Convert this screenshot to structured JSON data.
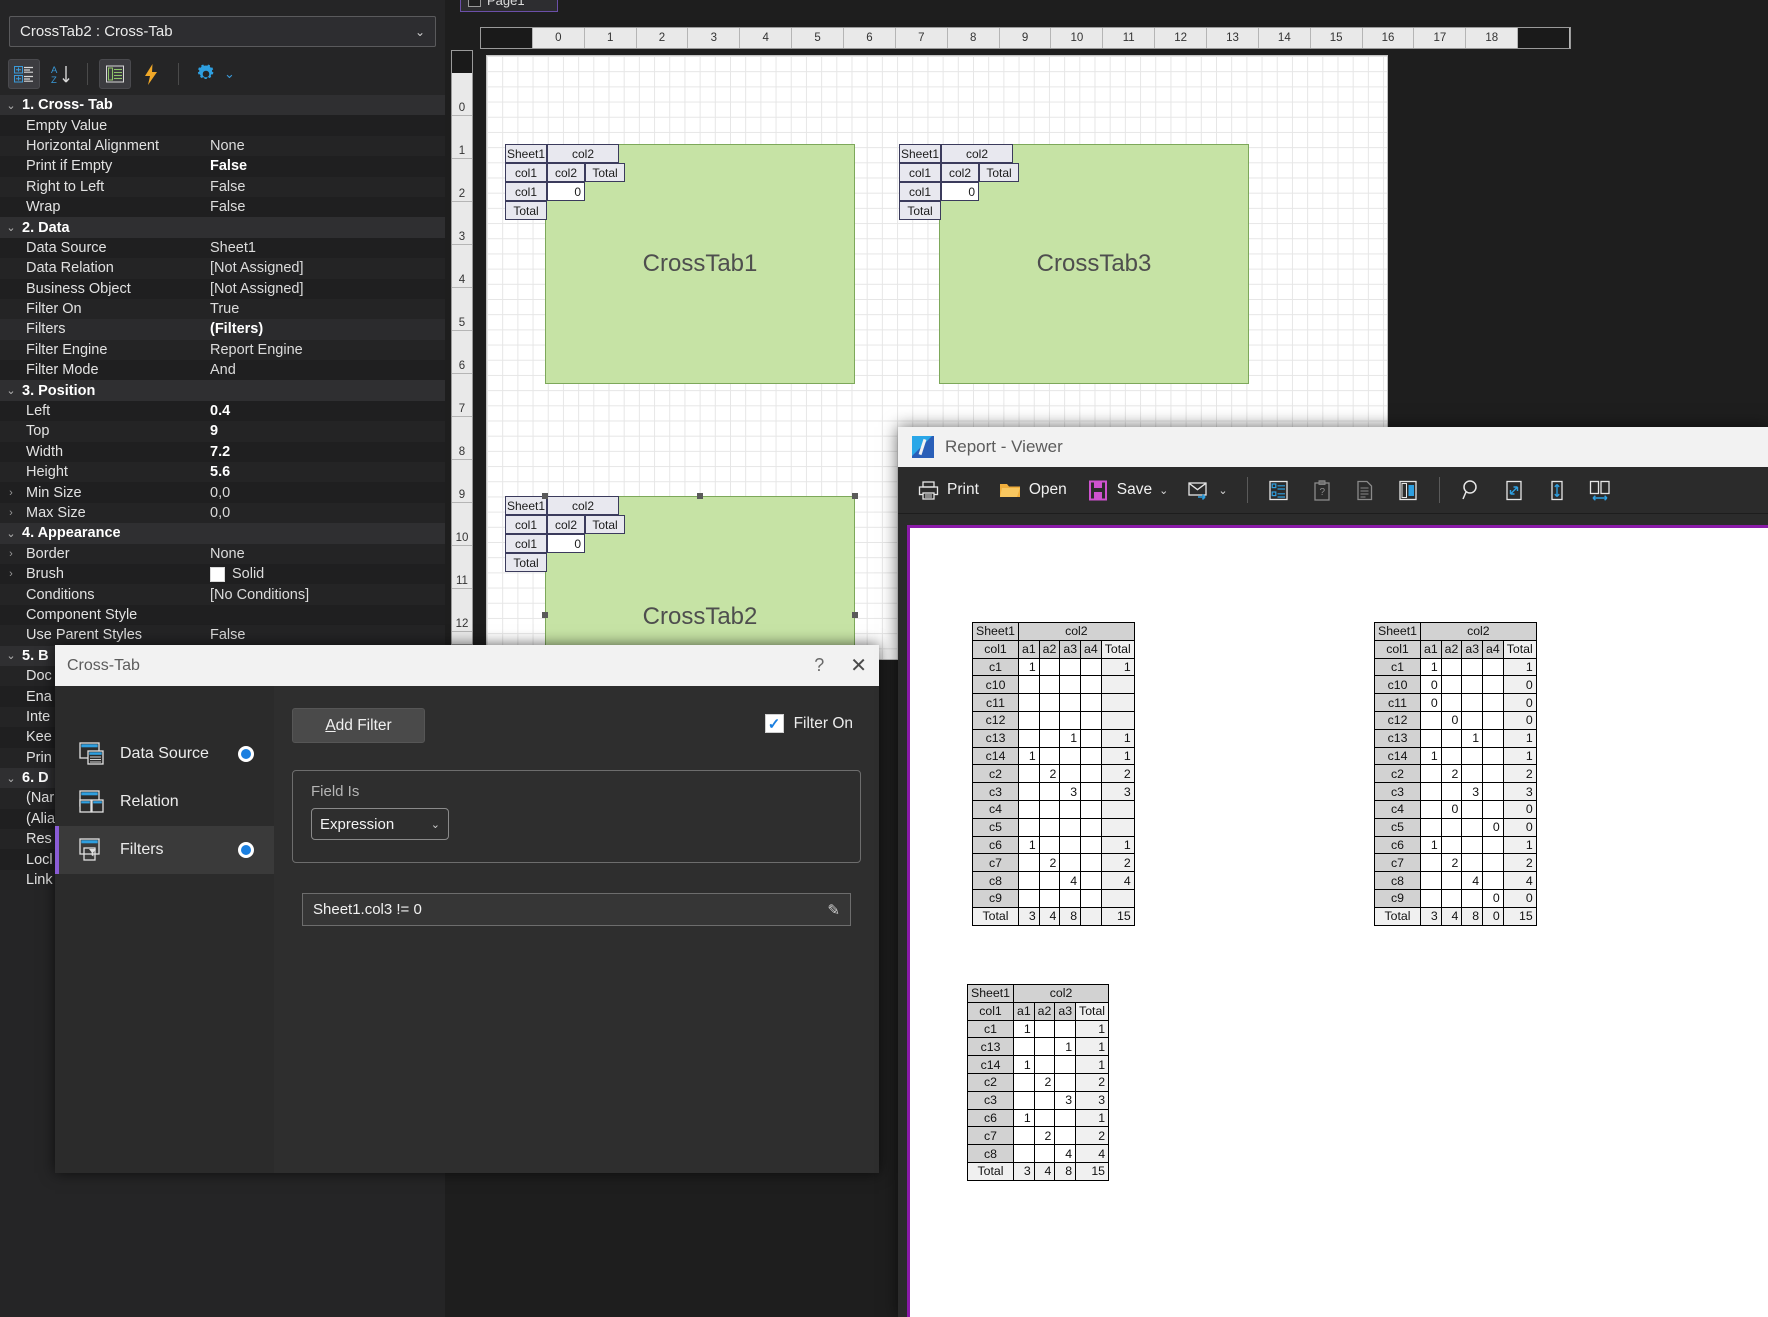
{
  "property_panel": {
    "object_selector": "CrossTab2 : Cross-Tab",
    "toolbar": {
      "categorized_icon": "categorized-view-icon",
      "alphabetical_icon": "alphabetical-sort-icon",
      "properties_icon": "properties-page-icon",
      "events_icon": "events-lightning-icon",
      "settings_icon": "gear-icon",
      "settings_chevron": "chevron-down-icon"
    },
    "groups": [
      {
        "title": "1. Cross- Tab",
        "rows": [
          {
            "name": "Empty Value",
            "value": "",
            "bold": false,
            "expand": false
          },
          {
            "name": "Horizontal Alignment",
            "value": "None",
            "bold": false,
            "expand": false
          },
          {
            "name": "Print if Empty",
            "value": "False",
            "bold": true,
            "expand": false
          },
          {
            "name": "Right to Left",
            "value": "False",
            "bold": false,
            "expand": false
          },
          {
            "name": "Wrap",
            "value": "False",
            "bold": false,
            "expand": false
          }
        ]
      },
      {
        "title": "2. Data",
        "rows": [
          {
            "name": "Data Source",
            "value": "Sheet1",
            "bold": false,
            "expand": false
          },
          {
            "name": "Data Relation",
            "value": "[Not Assigned]",
            "bold": false,
            "expand": false
          },
          {
            "name": "Business Object",
            "value": "[Not Assigned]",
            "bold": false,
            "expand": false
          },
          {
            "name": "Filter On",
            "value": "True",
            "bold": false,
            "expand": false
          },
          {
            "name": "Filters",
            "value": "(Filters)",
            "bold": true,
            "expand": false,
            "selected": true
          },
          {
            "name": "Filter Engine",
            "value": "Report Engine",
            "bold": false,
            "expand": false
          },
          {
            "name": "Filter Mode",
            "value": "And",
            "bold": false,
            "expand": false
          }
        ]
      },
      {
        "title": "3. Position",
        "rows": [
          {
            "name": "Left",
            "value": "0.4",
            "bold": true,
            "expand": false
          },
          {
            "name": "Top",
            "value": "9",
            "bold": true,
            "expand": false
          },
          {
            "name": "Width",
            "value": "7.2",
            "bold": true,
            "expand": false
          },
          {
            "name": "Height",
            "value": "5.6",
            "bold": true,
            "expand": false
          },
          {
            "name": "Min Size",
            "value": "0,0",
            "bold": false,
            "expand": true
          },
          {
            "name": "Max Size",
            "value": "0,0",
            "bold": false,
            "expand": true
          }
        ]
      },
      {
        "title": "4. Appearance",
        "rows": [
          {
            "name": "Border",
            "value": "None",
            "bold": false,
            "expand": true
          },
          {
            "name": "Brush",
            "value": "Solid",
            "bold": false,
            "expand": true,
            "swatch": "#ffffff"
          },
          {
            "name": "Conditions",
            "value": "[No Conditions]",
            "bold": false,
            "expand": false
          },
          {
            "name": "Component Style",
            "value": "",
            "bold": false,
            "expand": false
          },
          {
            "name": "Use Parent Styles",
            "value": "False",
            "bold": false,
            "expand": false
          }
        ]
      },
      {
        "title": "5. B",
        "rows": [
          {
            "name": "Doc",
            "value": "",
            "bold": false,
            "expand": false
          },
          {
            "name": "Ena",
            "value": "",
            "bold": false,
            "expand": false
          },
          {
            "name": "Inte",
            "value": "",
            "bold": false,
            "expand": false
          },
          {
            "name": "Kee",
            "value": "",
            "bold": false,
            "expand": false
          },
          {
            "name": "Prin",
            "value": "",
            "bold": false,
            "expand": false
          }
        ]
      },
      {
        "title": "6. D",
        "rows": [
          {
            "name": "(Nar",
            "value": "",
            "bold": false,
            "expand": false
          },
          {
            "name": "(Alia",
            "value": "",
            "bold": false,
            "expand": false
          },
          {
            "name": "Res",
            "value": "",
            "bold": false,
            "expand": false
          },
          {
            "name": "Locl",
            "value": "",
            "bold": false,
            "expand": false
          },
          {
            "name": "Link",
            "value": "",
            "bold": false,
            "expand": false
          }
        ]
      }
    ]
  },
  "designer": {
    "page_tab_label": "Page1",
    "h_ruler_ticks": [
      "0",
      "1",
      "2",
      "3",
      "4",
      "5",
      "6",
      "7",
      "8",
      "9",
      "10",
      "11",
      "12",
      "13",
      "14",
      "15",
      "16",
      "17",
      "18"
    ],
    "v_ruler_ticks": [
      "0",
      "1",
      "2",
      "3",
      "4",
      "5",
      "6",
      "7",
      "8",
      "9",
      "10",
      "11",
      "12"
    ],
    "crosstabs": [
      {
        "label": "CrossTab1",
        "corner": "Sheet1",
        "col_group": "col2",
        "row_header": "col1",
        "col_header": "col2",
        "total_label": "Total",
        "row_label": "col1",
        "row_total": "Total",
        "value": "0",
        "selected": false
      },
      {
        "label": "CrossTab3",
        "corner": "Sheet1",
        "col_group": "col2",
        "row_header": "col1",
        "col_header": "col2",
        "total_label": "Total",
        "row_label": "col1",
        "row_total": "Total",
        "value": "0",
        "selected": false
      },
      {
        "label": "CrossTab2",
        "corner": "Sheet1",
        "col_group": "col2",
        "row_header": "col1",
        "col_header": "col2",
        "total_label": "Total",
        "row_label": "col1",
        "row_total": "Total",
        "value": "0",
        "selected": true
      }
    ]
  },
  "dialog": {
    "title": "Cross-Tab",
    "help_glyph": "?",
    "close_glyph": "✕",
    "nav": [
      {
        "label": "Data Source",
        "icon": "data-source-icon",
        "radio": true,
        "selected": false
      },
      {
        "label": "Relation",
        "icon": "relation-icon",
        "radio": false,
        "selected": false
      },
      {
        "label": "Filters",
        "icon": "filters-icon",
        "radio": true,
        "selected": true
      }
    ],
    "add_filter_label": "Add Filter",
    "add_filter_accel": "A",
    "filter_on_label": "Filter On",
    "filter_on_checked": true,
    "field_is_label": "Field Is",
    "condition_type": "Expression",
    "expression_value": "Sheet1.col3 != 0",
    "edit_icon": "pencil-icon"
  },
  "viewer": {
    "title": "Report - Viewer",
    "logo": "stimulsoft-logo-icon",
    "toolbar": [
      {
        "label": "Print",
        "icon": "printer-icon",
        "has_chevron": false
      },
      {
        "label": "Open",
        "icon": "folder-open-icon",
        "has_chevron": false
      },
      {
        "label": "Save",
        "icon": "floppy-disk-icon",
        "has_chevron": true
      },
      {
        "label": "",
        "icon": "send-email-icon",
        "has_chevron": true
      },
      {
        "label": "",
        "icon": "bookmarks-panel-icon",
        "has_chevron": false
      },
      {
        "label": "",
        "icon": "parameters-panel-icon",
        "has_chevron": false
      },
      {
        "label": "",
        "icon": "page-view-icon",
        "has_chevron": false
      },
      {
        "label": "",
        "icon": "thumbnails-panel-icon",
        "has_chevron": false
      },
      {
        "label": "",
        "icon": "zoom-magnifier-icon",
        "has_chevron": false
      },
      {
        "label": "",
        "icon": "zoom-page-width-icon",
        "has_chevron": false
      },
      {
        "label": "",
        "icon": "zoom-one-page-icon",
        "has_chevron": false
      },
      {
        "label": "",
        "icon": "zoom-two-pages-icon",
        "has_chevron": false
      }
    ],
    "tables": [
      {
        "name": "crosstab1-report",
        "corner": "Sheet1",
        "col_group": "col2",
        "row_header": "col1",
        "columns": [
          "a1",
          "a2",
          "a3",
          "a4"
        ],
        "total_label": "Total",
        "rows": [
          {
            "label": "c1",
            "cells": [
              "1",
              "",
              "",
              ""
            ],
            "total": "1"
          },
          {
            "label": "c10",
            "cells": [
              "",
              "",
              "",
              ""
            ],
            "total": ""
          },
          {
            "label": "c11",
            "cells": [
              "",
              "",
              "",
              ""
            ],
            "total": ""
          },
          {
            "label": "c12",
            "cells": [
              "",
              "",
              "",
              ""
            ],
            "total": ""
          },
          {
            "label": "c13",
            "cells": [
              "",
              "",
              "1",
              ""
            ],
            "total": "1"
          },
          {
            "label": "c14",
            "cells": [
              "1",
              "",
              "",
              ""
            ],
            "total": "1"
          },
          {
            "label": "c2",
            "cells": [
              "",
              "2",
              "",
              ""
            ],
            "total": "2"
          },
          {
            "label": "c3",
            "cells": [
              "",
              "",
              "3",
              ""
            ],
            "total": "3"
          },
          {
            "label": "c4",
            "cells": [
              "",
              "",
              "",
              ""
            ],
            "total": ""
          },
          {
            "label": "c5",
            "cells": [
              "",
              "",
              "",
              ""
            ],
            "total": ""
          },
          {
            "label": "c6",
            "cells": [
              "1",
              "",
              "",
              ""
            ],
            "total": "1"
          },
          {
            "label": "c7",
            "cells": [
              "",
              "2",
              "",
              ""
            ],
            "total": "2"
          },
          {
            "label": "c8",
            "cells": [
              "",
              "",
              "4",
              ""
            ],
            "total": "4"
          },
          {
            "label": "c9",
            "cells": [
              "",
              "",
              "",
              ""
            ],
            "total": ""
          }
        ],
        "footer": {
          "label": "Total",
          "cells": [
            "3",
            "4",
            "8",
            ""
          ],
          "total": "15"
        }
      },
      {
        "name": "crosstab3-report",
        "corner": "Sheet1",
        "col_group": "col2",
        "row_header": "col1",
        "columns": [
          "a1",
          "a2",
          "a3",
          "a4"
        ],
        "total_label": "Total",
        "rows": [
          {
            "label": "c1",
            "cells": [
              "1",
              "",
              "",
              ""
            ],
            "total": "1"
          },
          {
            "label": "c10",
            "cells": [
              "0",
              "",
              "",
              ""
            ],
            "total": "0"
          },
          {
            "label": "c11",
            "cells": [
              "0",
              "",
              "",
              ""
            ],
            "total": "0"
          },
          {
            "label": "c12",
            "cells": [
              "",
              "0",
              "",
              ""
            ],
            "total": "0"
          },
          {
            "label": "c13",
            "cells": [
              "",
              "",
              "1",
              ""
            ],
            "total": "1"
          },
          {
            "label": "c14",
            "cells": [
              "1",
              "",
              "",
              ""
            ],
            "total": "1"
          },
          {
            "label": "c2",
            "cells": [
              "",
              "2",
              "",
              ""
            ],
            "total": "2"
          },
          {
            "label": "c3",
            "cells": [
              "",
              "",
              "3",
              ""
            ],
            "total": "3"
          },
          {
            "label": "c4",
            "cells": [
              "",
              "0",
              "",
              ""
            ],
            "total": "0"
          },
          {
            "label": "c5",
            "cells": [
              "",
              "",
              "",
              "0"
            ],
            "total": "0"
          },
          {
            "label": "c6",
            "cells": [
              "1",
              "",
              "",
              ""
            ],
            "total": "1"
          },
          {
            "label": "c7",
            "cells": [
              "",
              "2",
              "",
              ""
            ],
            "total": "2"
          },
          {
            "label": "c8",
            "cells": [
              "",
              "",
              "4",
              ""
            ],
            "total": "4"
          },
          {
            "label": "c9",
            "cells": [
              "",
              "",
              "",
              "0"
            ],
            "total": "0"
          }
        ],
        "footer": {
          "label": "Total",
          "cells": [
            "3",
            "4",
            "8",
            "0"
          ],
          "total": "15"
        }
      },
      {
        "name": "crosstab2-report",
        "corner": "Sheet1",
        "col_group": "col2",
        "row_header": "col1",
        "columns": [
          "a1",
          "a2",
          "a3"
        ],
        "total_label": "Total",
        "rows": [
          {
            "label": "c1",
            "cells": [
              "1",
              "",
              ""
            ],
            "total": "1"
          },
          {
            "label": "c13",
            "cells": [
              "",
              "",
              "1"
            ],
            "total": "1"
          },
          {
            "label": "c14",
            "cells": [
              "1",
              "",
              ""
            ],
            "total": "1"
          },
          {
            "label": "c2",
            "cells": [
              "",
              "2",
              ""
            ],
            "total": "2"
          },
          {
            "label": "c3",
            "cells": [
              "",
              "",
              "3"
            ],
            "total": "3"
          },
          {
            "label": "c6",
            "cells": [
              "1",
              "",
              ""
            ],
            "total": "1"
          },
          {
            "label": "c7",
            "cells": [
              "",
              "2",
              ""
            ],
            "total": "2"
          },
          {
            "label": "c8",
            "cells": [
              "",
              "",
              "4"
            ],
            "total": "4"
          }
        ],
        "footer": {
          "label": "Total",
          "cells": [
            "3",
            "4",
            "8"
          ],
          "total": "15"
        }
      }
    ]
  }
}
